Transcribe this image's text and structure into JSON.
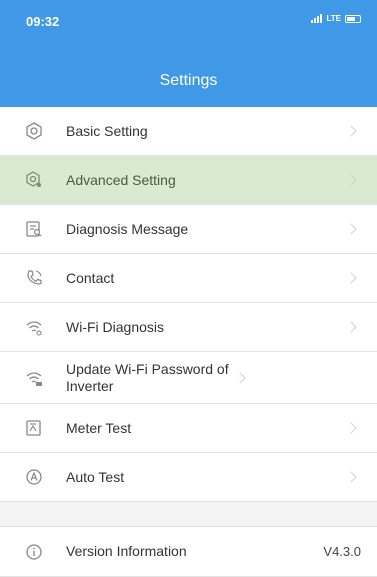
{
  "status_bar": {
    "time": "09:32",
    "network": "LTE"
  },
  "header": {
    "title": "Settings"
  },
  "menu": [
    {
      "label": "Basic Setting",
      "icon": "gear-icon"
    },
    {
      "label": "Advanced Setting",
      "icon": "advanced-gear-icon",
      "active": true
    },
    {
      "label": "Diagnosis Message",
      "icon": "document-search-icon"
    },
    {
      "label": "Contact",
      "icon": "phone-icon"
    },
    {
      "label": "Wi-Fi Diagnosis",
      "icon": "wifi-icon"
    },
    {
      "label": "Update Wi-Fi Password of Inverter",
      "icon": "wifi-key-icon"
    },
    {
      "label": "Meter Test",
      "icon": "meter-icon"
    },
    {
      "label": "Auto Test",
      "icon": "auto-test-icon"
    }
  ],
  "version": {
    "label": "Version Information",
    "value": "V4.3.0",
    "icon": "info-icon"
  },
  "colors": {
    "header": "#3f99e6",
    "active_row": "#d9ead0"
  }
}
